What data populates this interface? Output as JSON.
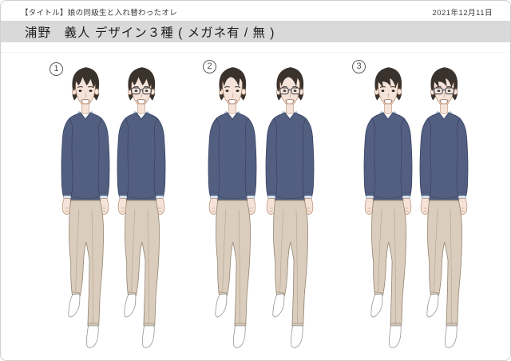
{
  "header": {
    "work_title": "【タイトル】娘の同級生と入れ替わったオレ",
    "date": "2021年12月11日",
    "sheet_title": "浦野　義人 デザイン３種 ( メガネ有 / 無 )"
  },
  "groups": [
    {
      "number": "1"
    },
    {
      "number": "2"
    },
    {
      "number": "3"
    }
  ],
  "colors": {
    "title_band": "#d9d9d9",
    "hair": "#3a322c",
    "skin": "#f5e3d9",
    "skin_outline": "#bb9076",
    "sweater": "#535f80",
    "sweater_line": "#3b4564",
    "shirt": "#dce6f2",
    "shirt_line": "#8fa3bf",
    "pants": "#dacdbd",
    "pants_outline": "#93836f",
    "sock": "#ffffff",
    "glasses": "#4b4b55"
  }
}
